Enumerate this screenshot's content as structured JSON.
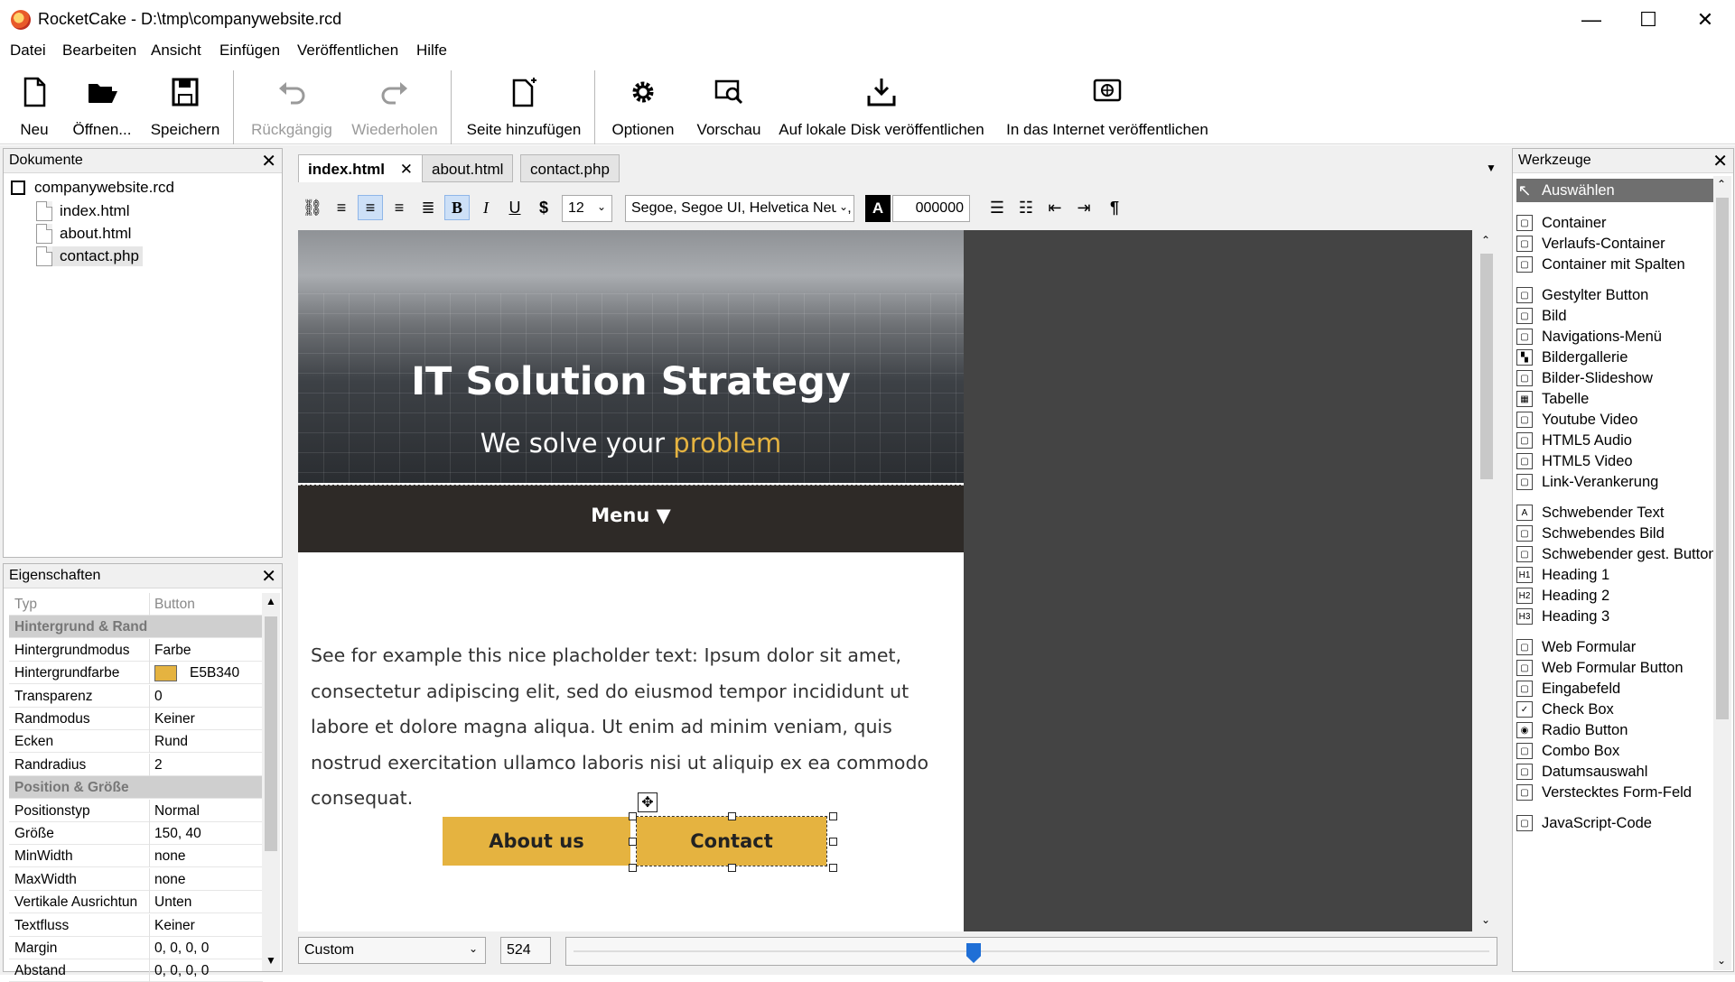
{
  "window": {
    "title": "RocketCake - D:\\tmp\\companywebsite.rcd",
    "minimize_glyph": "—",
    "maximize_glyph": "☐",
    "close_glyph": "✕"
  },
  "menu": [
    "Datei",
    "Bearbeiten",
    "Ansicht",
    "Einfügen",
    "Veröffentlichen",
    "Hilfe"
  ],
  "toolbar": {
    "new": "Neu",
    "open": "Öffnen...",
    "save": "Speichern",
    "undo": "Rückgängig",
    "redo": "Wiederholen",
    "add_page": "Seite hinzufügen",
    "options": "Optionen",
    "preview": "Vorschau",
    "publish_local": "Auf lokale Disk veröffentlichen",
    "publish_web": "In das Internet veröffentlichen"
  },
  "documents": {
    "title": "Dokumente",
    "project": "companywebsite.rcd",
    "files": [
      "index.html",
      "about.html",
      "contact.php"
    ]
  },
  "properties": {
    "title": "Eigenschaften",
    "rows": [
      {
        "key": "Typ",
        "value": "Button"
      },
      {
        "key": "Hintergrund & Rand",
        "value": ""
      },
      {
        "key": "Hintergrundmodus",
        "value": "Farbe"
      },
      {
        "key": "Hintergrundfarbe",
        "value": "E5B340"
      },
      {
        "key": "Transparenz",
        "value": "0"
      },
      {
        "key": "Randmodus",
        "value": "Keiner"
      },
      {
        "key": "Ecken",
        "value": "Rund"
      },
      {
        "key": "Randradius",
        "value": "2"
      },
      {
        "key": "Position & Größe",
        "value": ""
      },
      {
        "key": "Positionstyp",
        "value": "Normal"
      },
      {
        "key": "Größe",
        "value": "150, 40"
      },
      {
        "key": "MinWidth",
        "value": "none"
      },
      {
        "key": "MaxWidth",
        "value": "none"
      },
      {
        "key": "Vertikale Ausrichtun",
        "value": "Unten"
      },
      {
        "key": "Textfluss",
        "value": "Keiner"
      },
      {
        "key": "Margin",
        "value": "0, 0, 0, 0"
      },
      {
        "key": "Abstand",
        "value": "0, 0, 0, 0"
      }
    ]
  },
  "editor": {
    "tabs": [
      "index.html",
      "about.html",
      "contact.php"
    ],
    "font_size": "12",
    "font_family": "Segoe, Segoe UI, Helvetica Neue, sans",
    "text_color": "000000",
    "color_glyph": "A",
    "pilcrow": "¶",
    "fmt_glyphs": {
      "bold": "B",
      "italic": "I",
      "underline": "U",
      "dollar": "$"
    },
    "view_mode": "Custom",
    "view_width": "524"
  },
  "site": {
    "hero_title": "IT Solution Strategy",
    "hero_sub_prefix": "We solve your ",
    "hero_sub_accent": "problem",
    "menu_label": "Menu ▼",
    "body_text": "See for example this nice placholder text: Ipsum dolor sit amet, consectetur adipiscing elit, sed do eiusmod tempor incididunt ut labore et dolore magna aliqua. Ut enim ad minim veniam, quis nostrud exercitation ullamco laboris nisi ut aliquip ex ea commodo consequat.",
    "button_about": "About us",
    "button_contact": "Contact"
  },
  "tools": {
    "title": "Werkzeuge",
    "items": [
      {
        "label": "Auswählen",
        "icon": "cursor-icon"
      },
      {
        "label": "Container",
        "icon": "container-icon"
      },
      {
        "label": "Verlaufs-Container",
        "icon": "gradient-container-icon"
      },
      {
        "label": "Container mit Spalten",
        "icon": "columns-icon"
      },
      {
        "label": "Gestylter Button",
        "icon": "button-icon"
      },
      {
        "label": "Bild",
        "icon": "image-icon"
      },
      {
        "label": "Navigations-Menü",
        "icon": "nav-menu-icon"
      },
      {
        "label": "Bildergallerie",
        "icon": "gallery-icon"
      },
      {
        "label": "Bilder-Slideshow",
        "icon": "slideshow-icon"
      },
      {
        "label": "Tabelle",
        "icon": "table-icon"
      },
      {
        "label": "Youtube Video",
        "icon": "youtube-icon"
      },
      {
        "label": "HTML5 Audio",
        "icon": "audio-icon"
      },
      {
        "label": "HTML5 Video",
        "icon": "video-icon"
      },
      {
        "label": "Link-Verankerung",
        "icon": "anchor-icon"
      },
      {
        "label": "Schwebender Text",
        "icon": "floating-text-icon"
      },
      {
        "label": "Schwebendes Bild",
        "icon": "floating-image-icon"
      },
      {
        "label": "Schwebender gest. Button",
        "icon": "floating-button-icon"
      },
      {
        "label": "Heading 1",
        "icon": "h1-icon"
      },
      {
        "label": "Heading 2",
        "icon": "h2-icon"
      },
      {
        "label": "Heading 3",
        "icon": "h3-icon"
      },
      {
        "label": "Web Formular",
        "icon": "form-icon"
      },
      {
        "label": "Web Formular Button",
        "icon": "form-button-icon"
      },
      {
        "label": "Eingabefeld",
        "icon": "input-icon"
      },
      {
        "label": "Check Box",
        "icon": "checkbox-icon"
      },
      {
        "label": "Radio Button",
        "icon": "radio-icon"
      },
      {
        "label": "Combo Box",
        "icon": "combobox-icon"
      },
      {
        "label": "Datumsauswahl",
        "icon": "datepicker-icon"
      },
      {
        "label": "Verstecktes Form-Feld",
        "icon": "hidden-field-icon"
      },
      {
        "label": "JavaScript-Code",
        "icon": "javascript-icon"
      }
    ]
  },
  "colors": {
    "accent": "#E5B340",
    "site_menu_bg": "#2e2a27",
    "canvas_bg": "#444444"
  }
}
